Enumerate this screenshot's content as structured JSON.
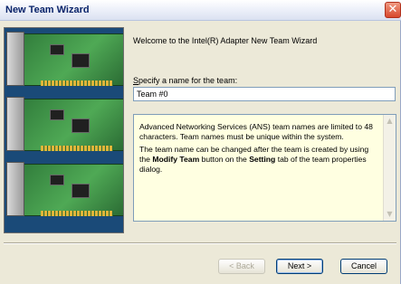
{
  "window": {
    "title": "New Team Wizard"
  },
  "welcome_text": "Welcome to the Intel(R) Adapter New Team Wizard",
  "name_field": {
    "label_prefix": "S",
    "label_rest": "pecify a name for the team:",
    "value": "Team #0"
  },
  "info": {
    "paragraph1": "Advanced Networking Services (ANS) team names are limited to 48 characters. Team names must be unique within the system.",
    "p2_part1": "The team name can be changed after the team is created by using the ",
    "p2_bold1": "Modify Team",
    "p2_part2": " button on the ",
    "p2_bold2": "Setting",
    "p2_part3": " tab of the team properties dialog."
  },
  "buttons": {
    "back": "< Back",
    "next": "Next >",
    "cancel": "Cancel"
  },
  "icons": {
    "close": "close-icon",
    "scroll_up": "scroll-up-arrow-icon",
    "scroll_down": "scroll-down-arrow-icon"
  },
  "colors": {
    "info_bg": "#ffffe1",
    "dialog_bg": "#ece9d8",
    "close": "#d8482c"
  }
}
